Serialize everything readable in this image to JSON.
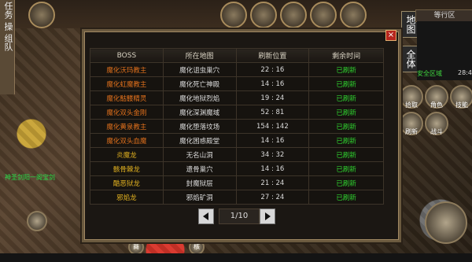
{
  "left_tabs": [
    "任务",
    "操",
    "组队"
  ],
  "right_tabs": {
    "map": "地图",
    "all": "全体"
  },
  "minimap": {
    "title": "等行区",
    "zone_label": "安全区域",
    "coords": "28:40"
  },
  "skills": [
    {
      "name": "拾取",
      "icon": "pickup-icon"
    },
    {
      "name": "角色",
      "icon": "character-icon"
    },
    {
      "name": "技能",
      "icon": "skill-icon"
    },
    {
      "name": "刷新",
      "icon": "refresh-icon"
    },
    {
      "name": "战斗",
      "icon": "battle-icon"
    }
  ],
  "player_name": "神圣剑阳一阁宝剑",
  "bottom_buttons": {
    "left": "商",
    "right": "核"
  },
  "dialog": {
    "headers": [
      "BOSS",
      "所在地图",
      "刷新位置",
      "剩余时间"
    ],
    "rows": [
      {
        "boss": "魔化沃玛教主",
        "map": "魔化诅虫巢穴",
        "pos": "22 : 16",
        "time": "已刷新"
      },
      {
        "boss": "魔化虹魔教主",
        "map": "魔化死亡神殿",
        "pos": "14 : 16",
        "time": "已刷新"
      },
      {
        "boss": "魔化骷髅精灵",
        "map": "魔化地狱烈焰",
        "pos": "19 : 24",
        "time": "已刷新"
      },
      {
        "boss": "魔化双头金刚",
        "map": "魔化深渊魔域",
        "pos": "52 : 81",
        "time": "已刷新"
      },
      {
        "boss": "魔化黄泉教主",
        "map": "魔化堕落坟场",
        "pos": "154 : 142",
        "time": "已刷新"
      },
      {
        "boss": "魔化双头血魔",
        "map": "魔化困惑殿堂",
        "pos": "14 : 16",
        "time": "已刷新"
      },
      {
        "boss": "炎魔龙",
        "map": "无名山洞",
        "pos": "34 : 32",
        "time": "已刷新"
      },
      {
        "boss": "骸骨棘龙",
        "map": "遗骨巢穴",
        "pos": "14 : 16",
        "time": "已刷新"
      },
      {
        "boss": "酷恶狱龙",
        "map": "封魔狱层",
        "pos": "21 : 24",
        "time": "已刷新"
      },
      {
        "boss": "邪焰龙",
        "map": "邪焰矿洞",
        "pos": "27 : 24",
        "time": "已刷新"
      }
    ],
    "pager": {
      "text": "1/10"
    }
  },
  "colors": {
    "boss_orange": "#e0701c",
    "boss_yellow": "#e0b020",
    "refresh_green": "#2fd42f",
    "close_red": "#b6261e"
  }
}
